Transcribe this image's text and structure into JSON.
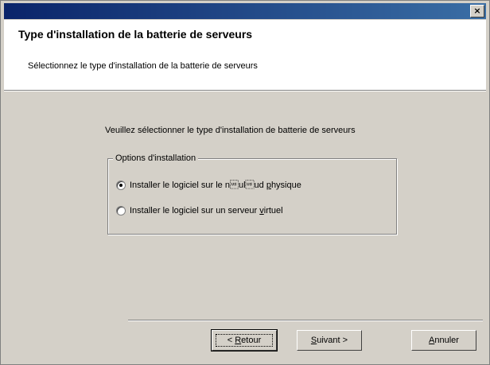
{
  "window": {
    "close_glyph": "×"
  },
  "header": {
    "title": "Type d'installation de la batterie de serveurs",
    "subtitle": "Sélectionnez le type d'installation de la batterie de serveurs"
  },
  "main": {
    "prompt": "Veuillez sélectionner le type d'installation de batterie de serveurs",
    "group_label": "Options d'installation",
    "options": [
      {
        "label_pre": "Installer le logiciel sur le n\u001ful\u001fud ",
        "label_ul": "p",
        "label_post": "hysique",
        "checked": true
      },
      {
        "label_pre": "Installer le logiciel sur un serveur ",
        "label_ul": "v",
        "label_post": "irtuel",
        "checked": false
      }
    ]
  },
  "buttons": {
    "back_pre": "< ",
    "back_ul": "R",
    "back_post": "etour",
    "next_ul": "S",
    "next_post": "uivant >",
    "cancel_ul": "A",
    "cancel_post": "nnuler"
  },
  "colors": {
    "titlebar": "#0a246a",
    "dialog_face": "#d4d0c8",
    "header_bg": "#ffffff"
  }
}
